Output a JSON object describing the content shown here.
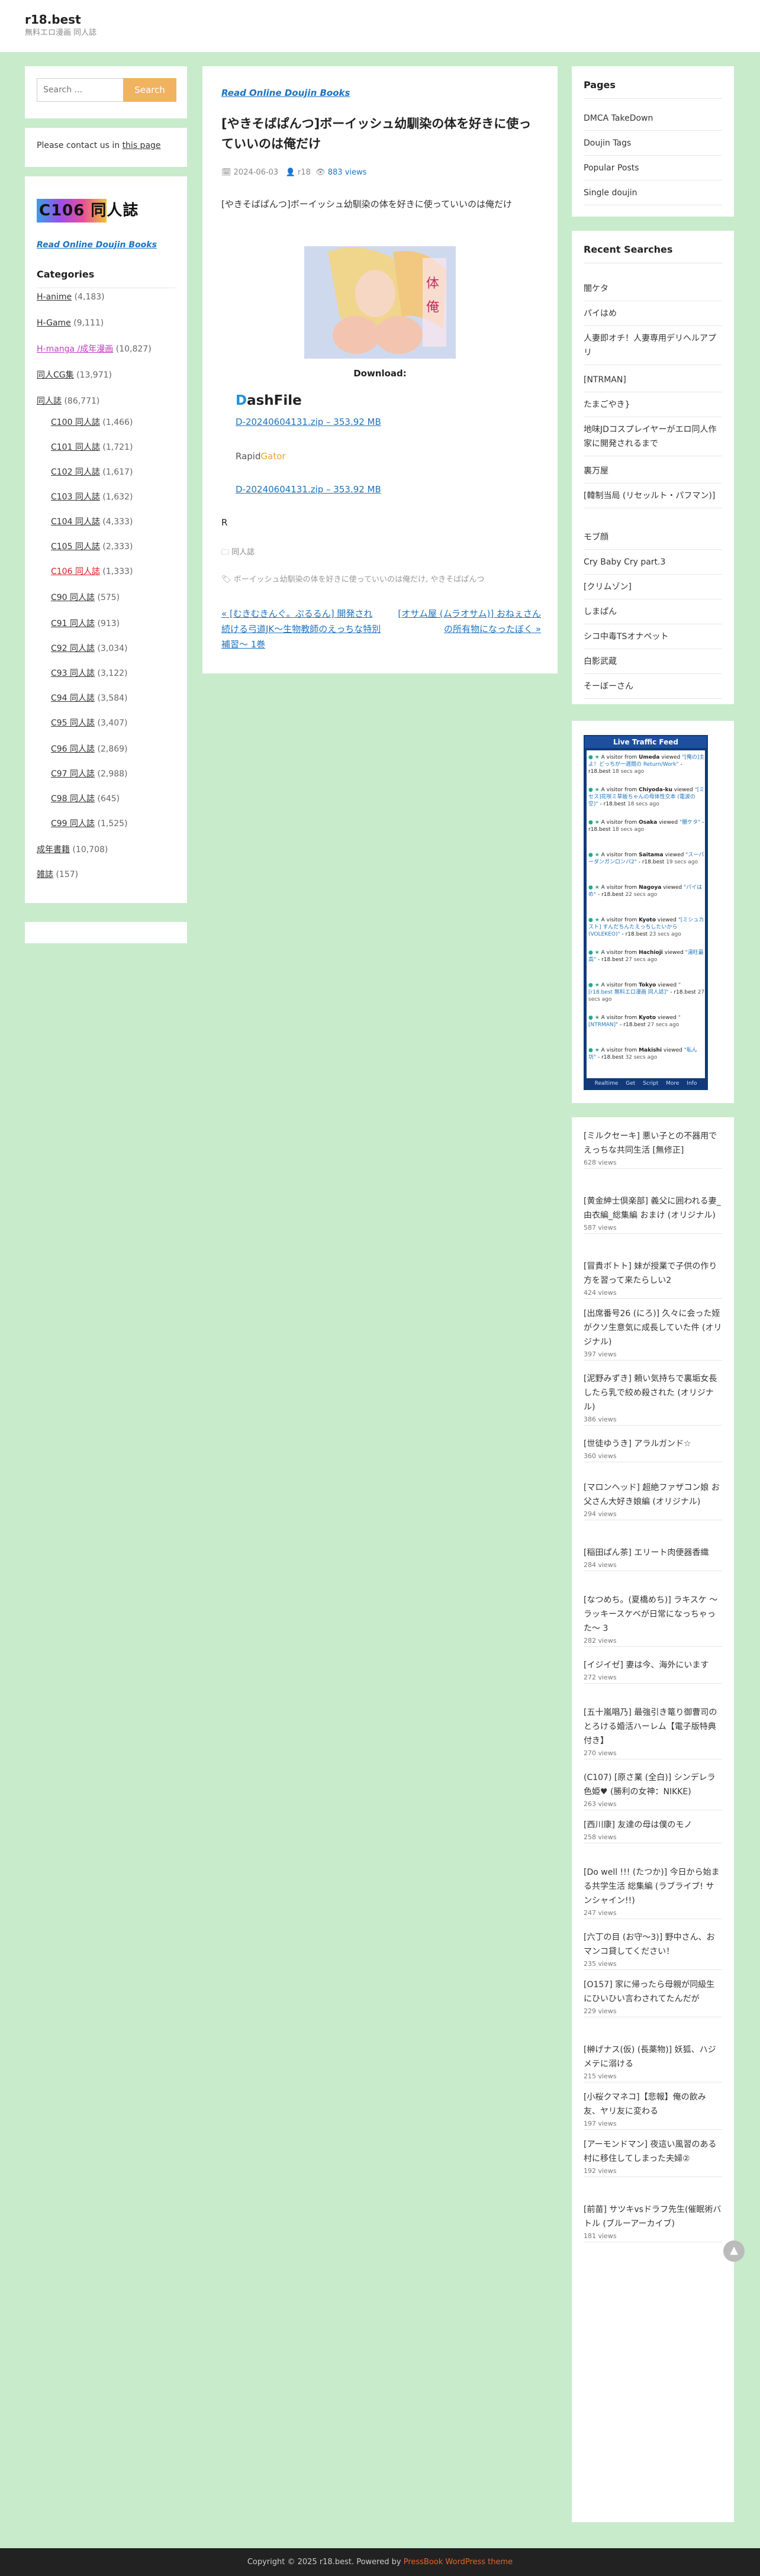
{
  "header": {
    "site_title": "r18.best",
    "tagline": "無料エロ漫画 同人誌"
  },
  "search": {
    "placeholder": "Search ...",
    "button": "Search"
  },
  "contact": {
    "prefix": "Please contact us in ",
    "link": "this page"
  },
  "left": {
    "banner": "C106 同人誌",
    "read_link": "Read Online Doujin Books",
    "categories_title": "Categories",
    "categories": [
      {
        "label": "H-anime",
        "count": "(4,183)"
      },
      {
        "label": "H-Game",
        "count": "(9,111)"
      },
      {
        "label": "H-manga /成年漫画",
        "count": "(10,827)"
      },
      {
        "label": "同人CG集",
        "count": "(13,971)"
      },
      {
        "label": "同人誌",
        "count": "(86,771)"
      },
      {
        "label": "C100 同人誌",
        "count": "(1,466)"
      },
      {
        "label": "C101 同人誌",
        "count": "(1,721)"
      },
      {
        "label": "C102 同人誌",
        "count": "(1,617)"
      },
      {
        "label": "C103 同人誌",
        "count": "(1,632)"
      },
      {
        "label": "C104 同人誌",
        "count": "(4,333)"
      },
      {
        "label": "C105 同人誌",
        "count": "(2,333)"
      },
      {
        "label": "C106 同人誌",
        "count": "(1,333)"
      },
      {
        "label": "C90 同人誌",
        "count": "(575)"
      },
      {
        "label": "C91 同人誌",
        "count": "(913)"
      },
      {
        "label": "C92 同人誌",
        "count": "(3,034)"
      },
      {
        "label": "C93 同人誌",
        "count": "(3,122)"
      },
      {
        "label": "C94 同人誌",
        "count": "(3,584)"
      },
      {
        "label": "C95 同人誌",
        "count": "(3,407)"
      },
      {
        "label": "C96 同人誌",
        "count": "(2,869)"
      },
      {
        "label": "C97 同人誌",
        "count": "(2,988)"
      },
      {
        "label": "C98 同人誌",
        "count": "(645)"
      },
      {
        "label": "C99 同人誌",
        "count": "(1,525)"
      },
      {
        "label": "成年書籍",
        "count": "(10,708)"
      },
      {
        "label": "雑誌",
        "count": "(157)"
      }
    ]
  },
  "post": {
    "category_link": "Read Online Doujin Books",
    "title": "[やきそばぱんつ]ボーイッシュ幼馴染の体を好きに使っていいのは俺だけ",
    "date": "2024-06-03",
    "author": "r18",
    "views": "883 views",
    "description": "[やきそばぱんつ]ボーイッシュ幼馴染の体を好きに使っていいのは俺だけ",
    "download_label": "Download:",
    "dashfile_a": "D",
    "dashfile_b": "ashFile",
    "dashfile_link": "D-20240604131.zip – 353.92 MB",
    "rapid_a": "Rapid",
    "rapid_b": "Gator",
    "rapid_link": "D-20240604131.zip – 353.92 MB",
    "r": "R",
    "tax": "同人誌",
    "tags": "ボーイッシュ幼馴染の体を好きに使っていいのは俺だけ, やきそばぱんつ",
    "prev": "« [むきむきんぐ。ぷるるん] 開発され続ける弓道JK〜生物教師のえっちな特別補習〜 1巻",
    "next": "[オサム屋 (ムラオサム)] おねぇさんの所有物になったぼく »"
  },
  "pages": {
    "title": "Pages",
    "items": [
      "DMCA TakeDown",
      "Doujin Tags",
      "Popular Posts",
      "Single doujin"
    ]
  },
  "recent": {
    "title": "Recent Searches",
    "items": [
      "闇ケタ",
      "パイはめ",
      "人妻即オチ！人妻専用デリヘルアプリ",
      "[NTRMAN]",
      "たまごやき}",
      "地味JDコスプレイヤーがエロ同人作家に開発されるまで",
      "裏万屋",
      "[韓制当局 (リセッルト・パフマン)]",
      "モブ顔",
      "Cry Baby Cry part.3",
      "[クリムゾン]",
      "しまぱん",
      "シコ中毒TSオナペット",
      "白影武蔵",
      "そーぼーさん"
    ]
  },
  "feed": {
    "title": "Live Traffic Feed",
    "footer": "Realtime Get Script More Info",
    "items": [
      {
        "loc": "Umeda",
        "page": "\"[俺の]主よ！どっちが一週間の Return/Work\"",
        "time": "18 secs ago"
      },
      {
        "loc": "Chiyoda-ku",
        "page": "\"[ミセス]花咲ミ草飯ちゃんの母体性交本 (電波の空)\"",
        "time": "18 secs ago"
      },
      {
        "loc": "Osaka",
        "page": "\"闇ケタ\"",
        "time": "18 secs ago"
      },
      {
        "loc": "Saitama",
        "page": "\"スーパーダンガンロンパ2\"",
        "time": "19 secs ago"
      },
      {
        "loc": "Nagoya",
        "page": "\"パイはめ\"",
        "time": "22 secs ago"
      },
      {
        "loc": "Kyoto",
        "page": "\"[ミシュカスト] すんだちんたえっちしたいから(VOLEKEO)\"",
        "time": "23 secs ago"
      },
      {
        "loc": "Hachioji",
        "page": "\"湯旺最高\"",
        "time": "27 secs ago"
      },
      {
        "loc": "Tokyo",
        "page": "\"[r18.best 無料エロ漫画 同人誌]\"",
        "time": "27 secs ago"
      },
      {
        "loc": "Kyoto",
        "page": "\"[NTRMAN]\"",
        "time": "27 secs ago"
      },
      {
        "loc": "Makishi",
        "page": "\"私ん坊\"",
        "time": "32 secs ago"
      }
    ]
  },
  "popular": [
    {
      "title": "[ミルクセーキ] 悪い子との不器用でえっちな共同生活 [無修正]",
      "views": "628 views"
    },
    {
      "title": "[黄金紳士倶楽部] 義父に囲われる妻_由衣編_総集編 おまけ (オリジナル)",
      "views": "587 views"
    },
    {
      "title": "[冒貴ボトト] 妹が授業で子供の作り方を習って来たらしい2",
      "views": "424 views"
    },
    {
      "title": "[出席番号26 (にろ)] 久々に会った姪がクソ生意気に成長していた件 (オリジナル)",
      "views": "397 views"
    },
    {
      "title": "[泥野みずき] 頼い気持ちで裏垢女長したら乳で絞め殺された (オリジナル)",
      "views": "386 views"
    },
    {
      "title": "[世徒ゆうき] アラルガンド☆",
      "views": "360 views"
    },
    {
      "title": "[マロンヘッド] 超絶ファザコン娘 お父さん大好き娘編 (オリジナル)",
      "views": "294 views"
    },
    {
      "title": "[稲田ぱん茶] エリート肉便器香織",
      "views": "284 views"
    },
    {
      "title": "[なつめち。(夏橋めち)] ラキスケ 〜ラッキースケベが日常になっちゃった〜 3",
      "views": "282 views"
    },
    {
      "title": "[イジイゼ] 妻は今、海外にいます",
      "views": "272 views"
    },
    {
      "title": "[五十嵐唱乃] 最強引き篭り御曹司のとろける婚活ハーレム【電子版特典付き】",
      "views": "270 views"
    },
    {
      "title": "(C107) [原さ業 (全白)] シンデレラ色姫♥ (勝利の女神：NIKKE)",
      "views": "263 views"
    },
    {
      "title": "[西川康] 友達の母は僕のモノ",
      "views": "258 views"
    },
    {
      "title": "[Do well !!! (たつか)] 今日から始まる共学生活 総集編 (ラブライブ! サンシャイン!!)",
      "views": "247 views"
    },
    {
      "title": "[六丁の目 (お守〜3)] 野中さん、おマンコ貸してください！",
      "views": "235 views"
    },
    {
      "title": "[O157] 家に帰ったら母親が同級生にひいひい言わされてたんだが",
      "views": "229 views"
    },
    {
      "title": "[榊げナス(仮) (長薬物)] 妖狐、ハジメテに溺ける",
      "views": "215 views"
    },
    {
      "title": "[小桜クマネコ]【悲報】俺の飲み友、ヤリ友に変わる",
      "views": "197 views"
    },
    {
      "title": "[アーモンドマン] 夜這い風習のある村に移住してしまった夫婦②",
      "views": "192 views"
    },
    {
      "title": "[前苗] サツキvsドラフ先生(催眠術バトル (ブルーアーカイブ)",
      "views": "181 views"
    }
  ],
  "footer": {
    "text": "Copyright © 2025 r18.best. Powered by ",
    "link": "PressBook WordPress theme"
  }
}
